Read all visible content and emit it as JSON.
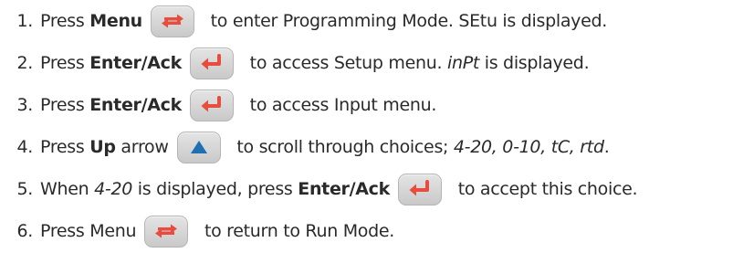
{
  "icons": {
    "menu": "menu-cycle-icon",
    "enter": "enter-return-icon",
    "up": "up-arrow-icon"
  },
  "steps": [
    {
      "num": "1.",
      "a": "Press ",
      "b": "Menu",
      "c": " to enter Programming Mode. SEtu is displayed."
    },
    {
      "num": "2.",
      "a": "Press ",
      "b": "Enter/Ack",
      "c": " to access Setup menu. ",
      "d": "inPt",
      "e": " is displayed."
    },
    {
      "num": "3.",
      "a": "Press ",
      "b": "Enter/Ack",
      "c": " to access Input menu."
    },
    {
      "num": "4.",
      "a": "Press ",
      "b": "Up",
      "c": " arrow",
      "d": " to scroll through choices; ",
      "e": "4-20, 0-10, tC, rtd",
      "f": "."
    },
    {
      "num": "5.",
      "a": "When ",
      "b": "4-20",
      "c": " is displayed, press ",
      "d": "Enter/Ack",
      "e": " to accept this choice."
    },
    {
      "num": "6.",
      "a": "Press Menu",
      "c": " to return to Run Mode."
    }
  ]
}
